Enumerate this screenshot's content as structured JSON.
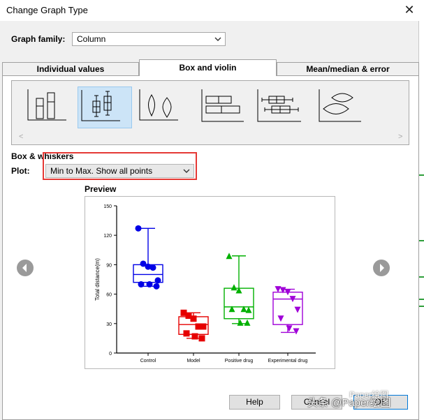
{
  "window": {
    "title": "Change Graph Type",
    "close_glyph": "✕"
  },
  "family": {
    "label": "Graph family:",
    "value": "Column"
  },
  "tabs": [
    {
      "label": "Individual values",
      "active": false
    },
    {
      "label": "Box and violin",
      "active": true
    },
    {
      "label": "Mean/median & error",
      "active": false
    }
  ],
  "gallery": {
    "items": [
      {
        "name": "box-plot-icon",
        "selected": false
      },
      {
        "name": "box-plot-with-whiskers-icon",
        "selected": true
      },
      {
        "name": "violin-plot-icon",
        "selected": false
      },
      {
        "name": "horizontal-box-plot-icon",
        "selected": false
      },
      {
        "name": "horizontal-box-whiskers-icon",
        "selected": false
      },
      {
        "name": "horizontal-violin-plot-icon",
        "selected": false
      }
    ],
    "scroll_left": "<",
    "scroll_right": ">"
  },
  "options": {
    "section_label": "Box & whiskers",
    "plot_label": "Plot:",
    "plot_value": "Min to Max. Show all points"
  },
  "preview": {
    "label": "Preview"
  },
  "buttons": {
    "help": "Help",
    "cancel": "Cancel",
    "ok": "OK"
  },
  "watermark": {
    "text": "头条 @Paper绘图",
    "sub": "Paper绘图"
  },
  "colors": {
    "control": "#0000e6",
    "model": "#e60000",
    "positive": "#00b000",
    "experimental": "#a000d8",
    "highlight": "#e53935",
    "selection": "#cce4f7"
  },
  "chart_data": {
    "type": "box",
    "ylabel": "Total distance(m)",
    "ylim": [
      0,
      150
    ],
    "yticks": [
      0,
      30,
      60,
      90,
      120,
      150
    ],
    "categories": [
      "Control",
      "Model",
      "Positive drug",
      "Experimental drug"
    ],
    "series": [
      {
        "category": "Control",
        "min": 68,
        "q1": 72,
        "median": 80,
        "q3": 90,
        "max": 127,
        "points": [
          127,
          91,
          88,
          87,
          74,
          70,
          70,
          68
        ],
        "marker": "circle"
      },
      {
        "category": "Model",
        "min": 15,
        "q1": 19,
        "median": 29,
        "q3": 37,
        "max": 41,
        "points": [
          41,
          38,
          35,
          27,
          27,
          20,
          17,
          15
        ],
        "marker": "square"
      },
      {
        "category": "Positive drug",
        "min": 30,
        "q1": 35,
        "median": 47,
        "q3": 66,
        "max": 99,
        "points": [
          99,
          67,
          64,
          45,
          44,
          45,
          31,
          31
        ],
        "marker": "triangle-up"
      },
      {
        "category": "Experimental drug",
        "min": 21,
        "q1": 29,
        "median": 55,
        "q3": 62,
        "max": 65,
        "points": [
          65,
          64,
          62,
          55,
          44,
          35,
          25,
          22
        ],
        "marker": "triangle-down"
      }
    ]
  }
}
